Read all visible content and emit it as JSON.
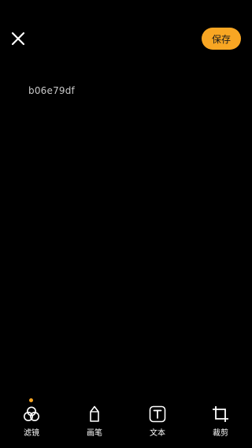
{
  "header": {
    "close_icon": "close-icon",
    "save_label": "保存"
  },
  "canvas": {
    "image_text": "b06e79df"
  },
  "toolbar": {
    "tools": [
      {
        "label": "滤镜",
        "icon": "filter-icon",
        "active": true
      },
      {
        "label": "画笔",
        "icon": "brush-icon",
        "active": false
      },
      {
        "label": "文本",
        "icon": "text-icon",
        "active": false
      },
      {
        "label": "裁剪",
        "icon": "crop-icon",
        "active": false
      }
    ]
  },
  "colors": {
    "background": "#000000",
    "accent": "#f8a623",
    "icon": "#ffffff"
  }
}
